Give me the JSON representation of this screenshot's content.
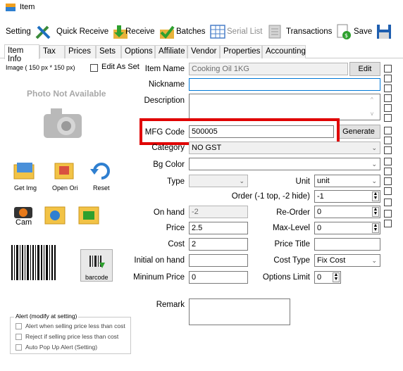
{
  "window": {
    "title": "Item"
  },
  "toolbar": {
    "setting": "Setting",
    "quick_receive": "Quick Receive",
    "receive": "Receive",
    "batches": "Batches",
    "serial_list": "Serial List",
    "transactions": "Transactions",
    "save": "Save"
  },
  "tabs": [
    "Item Info",
    "Tax",
    "Prices",
    "Sets",
    "Options",
    "Affiliate",
    "Vendor",
    "Properties",
    "Accounting"
  ],
  "left": {
    "image_label": "Image ( 150 px * 150 px)",
    "edit_as_set": "Edit As Set",
    "photo_na": "Photo Not Available",
    "get_img": "Get Img",
    "open_ori": "Open Ori",
    "reset": "Reset",
    "cam": "Cam",
    "barcode": "barcode",
    "alert_title": "Alert (modify at setting)",
    "alert_opts": [
      "Alert when selling price less than cost",
      "Reject if selling price less than cost",
      "Auto Pop Up Alert (Setting)"
    ]
  },
  "form": {
    "item_name_label": "Item Name",
    "item_name": "Cooking Oil 1KG",
    "edit_btn": "Edit",
    "nickname_label": "Nickname",
    "nickname": "",
    "description_label": "Description",
    "description": "",
    "mfg_label": "MFG Code",
    "mfg": "500005",
    "generate_btn": "Generate",
    "category_label": "Category",
    "category": "NO GST",
    "bgcolor_label": "Bg Color",
    "bgcolor": "",
    "type_label": "Type",
    "type": "",
    "unit_label": "Unit",
    "unit": "unit",
    "order_label": "Order (-1 top, -2 hide)",
    "order": "-1",
    "onhand_label": "On hand",
    "onhand": "-2",
    "reorder_label": "Re-Order",
    "reorder": "0",
    "price_label": "Price",
    "price": "2.5",
    "maxlevel_label": "Max-Level",
    "maxlevel": "0",
    "cost_label": "Cost",
    "cost": "2",
    "pricetitle_label": "Price Title",
    "pricetitle": "",
    "initial_label": "Initial on hand",
    "initial": "",
    "costtype_label": "Cost Type",
    "costtype": "Fix Cost",
    "minprice_label": "Mininum Price",
    "minprice": "0",
    "optlimit_label": "Options Limit",
    "optlimit": "0",
    "remark_label": "Remark",
    "remark": ""
  }
}
